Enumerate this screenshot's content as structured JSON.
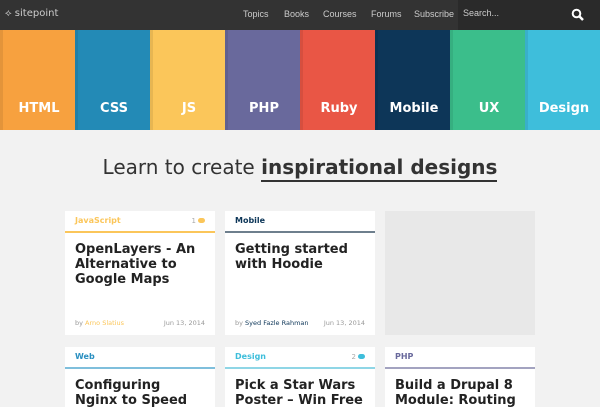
{
  "header": {
    "logo": "sitepoint",
    "nav": [
      "Topics",
      "Books",
      "Courses",
      "Forums",
      "Subscribe"
    ],
    "search_placeholder": "Search..."
  },
  "tiles": [
    {
      "label": "HTML",
      "color": "#f7a13f"
    },
    {
      "label": "CSS",
      "color": "#238ab6"
    },
    {
      "label": "JS",
      "color": "#fbc65a"
    },
    {
      "label": "PHP",
      "color": "#69699c"
    },
    {
      "label": "Ruby",
      "color": "#e95645"
    },
    {
      "label": "Mobile",
      "color": "#0d3658"
    },
    {
      "label": "UX",
      "color": "#3bbe8b"
    },
    {
      "label": "Design",
      "color": "#3ebedb"
    }
  ],
  "headline": {
    "prefix": "Learn to create ",
    "emphasis": "inspirational designs"
  },
  "cards": [
    {
      "category": "JavaScript",
      "color": "#fbc65a",
      "comments": "1",
      "title": "OpenLayers - An Alternative to Google Maps",
      "by": "by ",
      "author": "Arno Slatius",
      "date": "Jun 13, 2014"
    },
    {
      "category": "Mobile",
      "color": "#0d3658",
      "border": "#6e7f8d",
      "title": "Getting started with Hoodie",
      "by": "by ",
      "author": "Syed Fazle Rahman",
      "date": "Jun 13, 2014"
    },
    {
      "category": "Web",
      "color": "#2a8fc0",
      "border": "#7fbfdc",
      "title": "Configuring Nginx to Speed Up Your"
    },
    {
      "category": "Design",
      "color": "#3ebedb",
      "border": "#8fd6e6",
      "comments": "2",
      "title": "Pick a Star Wars Poster – Win Free"
    },
    {
      "category": "PHP",
      "color": "#69699c",
      "border": "#a3a3c0",
      "title": "Build a Drupal 8 Module: Routing"
    }
  ]
}
